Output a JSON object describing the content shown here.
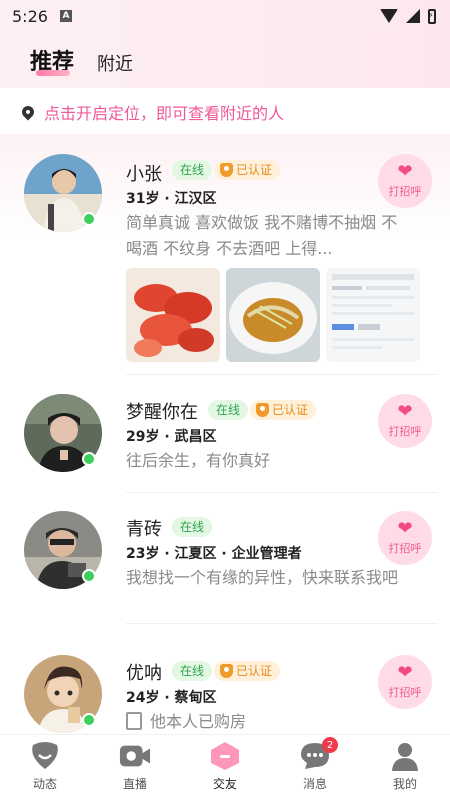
{
  "status_bar": {
    "time": "5:26",
    "app_icon": "A"
  },
  "header": {
    "tab_recommend": "推荐",
    "tab_nearby": "附近"
  },
  "location_prompt": "点击开启定位，即可查看附近的人",
  "users": [
    {
      "name": "小张",
      "online": "在线",
      "verified": "已认证",
      "meta": "31岁 · 江汉区",
      "bio": "简单真诚 喜欢做饭 我不赌博不抽烟 不喝酒 不纹身 不去酒吧 上得...",
      "greet": "打招呼"
    },
    {
      "name": "梦醒你在",
      "online": "在线",
      "verified": "已认证",
      "meta": "29岁 · 武昌区",
      "bio": "往后余生，有你真好",
      "greet": "打招呼"
    },
    {
      "name": "青砖",
      "online": "在线",
      "meta": "23岁 · 江夏区 · 企业管理者",
      "bio": "我想找一个有缘的异性，快来联系我吧",
      "greet": "打招呼"
    },
    {
      "name": "优呐",
      "online": "在线",
      "verified": "已认证",
      "meta": "24岁 · 蔡甸区",
      "bio": "他本人已购房",
      "greet": "打招呼"
    }
  ],
  "tabbar": {
    "items": [
      {
        "label": "动态"
      },
      {
        "label": "直播"
      },
      {
        "label": "交友"
      },
      {
        "label": "消息",
        "badge": "2"
      },
      {
        "label": "我的"
      }
    ]
  },
  "colors": {
    "accent": "#f0589a",
    "online_green": "#3ccf5c",
    "verified_orange": "#e78b1a"
  }
}
